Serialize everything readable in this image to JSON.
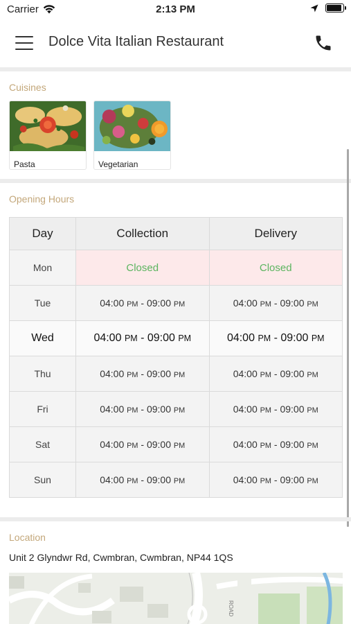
{
  "status_bar": {
    "carrier": "Carrier",
    "time": "2:13 PM",
    "battery_level": 0.9
  },
  "header": {
    "title": "Dolce Vita Italian Restaurant",
    "menu_icon": "hamburger-menu-icon",
    "call_icon": "phone-icon"
  },
  "cuisines": {
    "label": "Cuisines",
    "items": [
      {
        "name": "Pasta"
      },
      {
        "name": "Vegetarian"
      }
    ]
  },
  "opening_hours": {
    "label": "Opening Hours",
    "columns": [
      "Day",
      "Collection",
      "Delivery"
    ],
    "rows": [
      {
        "day": "Mon",
        "collection": "Closed",
        "delivery": "Closed",
        "closed": true
      },
      {
        "day": "Tue",
        "collection": {
          "from": "04:00",
          "from_ampm": "PM",
          "sep": " - ",
          "to": "09:00",
          "to_ampm": "PM"
        },
        "delivery": {
          "from": "04:00",
          "from_ampm": "PM",
          "sep": " - ",
          "to": "09:00",
          "to_ampm": "PM"
        }
      },
      {
        "day": "Wed",
        "today": true,
        "collection": {
          "from": "04:00",
          "from_ampm": "PM",
          "sep": " - ",
          "to": "09:00",
          "to_ampm": "PM"
        },
        "delivery": {
          "from": "04:00",
          "from_ampm": "PM",
          "sep": " - ",
          "to": "09:00",
          "to_ampm": "PM"
        }
      },
      {
        "day": "Thu",
        "collection": {
          "from": "04:00",
          "from_ampm": "PM",
          "sep": " - ",
          "to": "09:00",
          "to_ampm": "PM"
        },
        "delivery": {
          "from": "04:00",
          "from_ampm": "PM",
          "sep": " - ",
          "to": "09:00",
          "to_ampm": "PM"
        }
      },
      {
        "day": "Fri",
        "collection": {
          "from": "04:00",
          "from_ampm": "PM",
          "sep": " - ",
          "to": "09:00",
          "to_ampm": "PM"
        },
        "delivery": {
          "from": "04:00",
          "from_ampm": "PM",
          "sep": " - ",
          "to": "09:00",
          "to_ampm": "PM"
        }
      },
      {
        "day": "Sat",
        "collection": {
          "from": "04:00",
          "from_ampm": "PM",
          "sep": " - ",
          "to": "09:00",
          "to_ampm": "PM"
        },
        "delivery": {
          "from": "04:00",
          "from_ampm": "PM",
          "sep": " - ",
          "to": "09:00",
          "to_ampm": "PM"
        }
      },
      {
        "day": "Sun",
        "collection": {
          "from": "04:00",
          "from_ampm": "PM",
          "sep": " - ",
          "to": "09:00",
          "to_ampm": "PM"
        },
        "delivery": {
          "from": "04:00",
          "from_ampm": "PM",
          "sep": " - ",
          "to": "09:00",
          "to_ampm": "PM"
        }
      }
    ]
  },
  "location": {
    "label": "Location",
    "address": "Unit 2 Glyndwr Rd, Cwmbran, Cwmbran, NP44 1QS",
    "map_road_label": "ROAD"
  },
  "colors": {
    "section_label": "#c3a77a",
    "closed_text": "#5bb45f",
    "closed_bg": "#fde9ea"
  }
}
